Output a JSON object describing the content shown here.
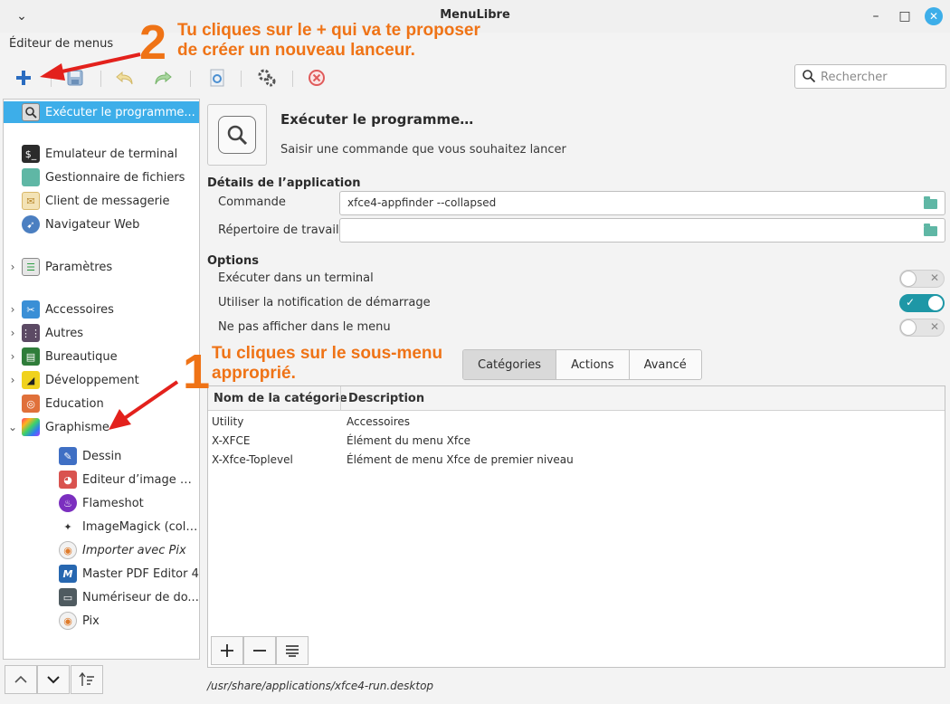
{
  "window": {
    "title": "MenuLibre",
    "menu_chevron": "⌄",
    "minimize_glyph": "–",
    "maximize_glyph": "□",
    "close_glyph": "✕"
  },
  "menubar": {
    "label": "Éditeur de menus"
  },
  "toolbar": {
    "items": [
      "add-icon",
      "save-icon",
      "undo-icon",
      "redo-icon",
      "revert-icon",
      "execute-icon",
      "delete-icon"
    ]
  },
  "search": {
    "placeholder": "Rechercher"
  },
  "sidebar": {
    "selected": "Exécuter le programme...",
    "items": [
      {
        "label": "Émulateur de terminal"
      },
      {
        "label": "Gestionnaire de fichiers"
      },
      {
        "label": "Client de messagerie"
      },
      {
        "label": "Navigateur Web"
      },
      {
        "label": "Paramètres"
      },
      {
        "label": "Accessoires"
      },
      {
        "label": "Autres"
      },
      {
        "label": "Bureautique"
      },
      {
        "label": "Développement"
      },
      {
        "label": "Éducation"
      },
      {
        "label": "Graphisme"
      }
    ],
    "children": [
      {
        "label": "Dessin"
      },
      {
        "label": "Éditeur d’image GI..."
      },
      {
        "label": "Flameshot"
      },
      {
        "label": "ImageMagick (colo..."
      },
      {
        "label": "Importer avec Pix"
      },
      {
        "label": "Master PDF Editor 4"
      },
      {
        "label": "Numériseur de do..."
      },
      {
        "label": "Pix"
      }
    ],
    "bottom_buttons": [
      "move-up-icon",
      "move-down-icon",
      "sort-icon"
    ]
  },
  "app": {
    "name": "Exécuter le programme…",
    "comment": "Saisir une commande que vous souhaitez lancer"
  },
  "details": {
    "heading": "Détails de l’application",
    "command_label": "Commande",
    "command_value": "xfce4-appfinder --collapsed",
    "workdir_label": "Répertoire de travail",
    "workdir_value": ""
  },
  "options": {
    "heading": "Options",
    "terminal_label": "Exécuter dans un terminal",
    "terminal_on": false,
    "startup_label": "Utiliser la notification de démarrage",
    "startup_on": true,
    "nodisplay_label": "Ne pas afficher dans le menu",
    "nodisplay_on": false
  },
  "tabs": {
    "categories": "Catégories",
    "actions": "Actions",
    "advanced": "Avancé",
    "active": "Catégories"
  },
  "categories_table": {
    "headers": [
      "Nom de la catégorie",
      "Description"
    ],
    "rows": [
      [
        "Utility",
        "Accessoires"
      ],
      [
        "X-XFCE",
        "Élément du menu Xfce"
      ],
      [
        "X-Xfce-Toplevel",
        "Élément de menu Xfce de premier niveau"
      ]
    ]
  },
  "table_buttons": {
    "add": "+",
    "remove": "−"
  },
  "filepath": "/usr/share/applications/xfce4-run.desktop",
  "annotations": {
    "step2_number": "2",
    "step2_text_line1": "Tu cliques sur le + qui va te proposer",
    "step2_text_line2": "de créer un nouveau lanceur.",
    "step1_number": "1",
    "step1_text_line1": "Tu cliques sur le sous-menu",
    "step1_text_line2": "approprié.",
    "color": "#ef7316",
    "arrow_color": "#e3211c"
  },
  "colors": {
    "accent": "#3daee9",
    "toggle_on": "#1e97a6"
  }
}
